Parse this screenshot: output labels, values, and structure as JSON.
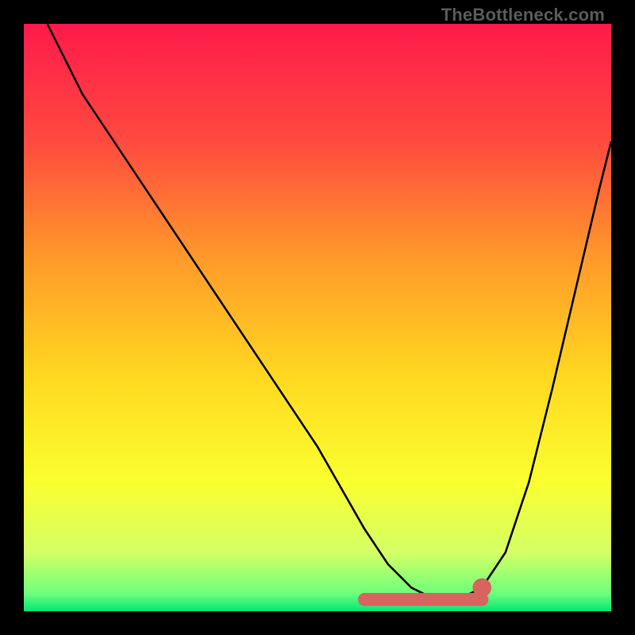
{
  "watermark": "TheBottleneck.com",
  "chart_data": {
    "type": "line",
    "title": "",
    "xlabel": "",
    "ylabel": "",
    "xlim": [
      0,
      100
    ],
    "ylim": [
      0,
      100
    ],
    "grid": false,
    "legend": false,
    "background_gradient": {
      "stops": [
        {
          "offset": 0.0,
          "color": "#ff1a4b"
        },
        {
          "offset": 0.2,
          "color": "#ff4a3f"
        },
        {
          "offset": 0.4,
          "color": "#ff9a2a"
        },
        {
          "offset": 0.6,
          "color": "#ffd820"
        },
        {
          "offset": 0.78,
          "color": "#faff2f"
        },
        {
          "offset": 0.9,
          "color": "#d4ff66"
        },
        {
          "offset": 0.97,
          "color": "#6dff7a"
        },
        {
          "offset": 1.0,
          "color": "#00e676"
        }
      ]
    },
    "series": [
      {
        "name": "bottleneck-curve",
        "color": "#000000",
        "x": [
          4,
          10,
          20,
          30,
          40,
          50,
          58,
          62,
          66,
          70,
          74,
          78,
          82,
          86,
          90,
          94,
          98,
          100
        ],
        "y": [
          100,
          88,
          73,
          58,
          43,
          28,
          14,
          8,
          4,
          2,
          2,
          4,
          10,
          22,
          38,
          55,
          72,
          80
        ]
      }
    ],
    "flat_segment": {
      "name": "highlight-plateau",
      "color": "#d8635f",
      "x_start": 58,
      "x_end": 78,
      "y": 2,
      "thickness_model_units": 2.2,
      "end_dot_radius_model_units": 1.6
    }
  }
}
